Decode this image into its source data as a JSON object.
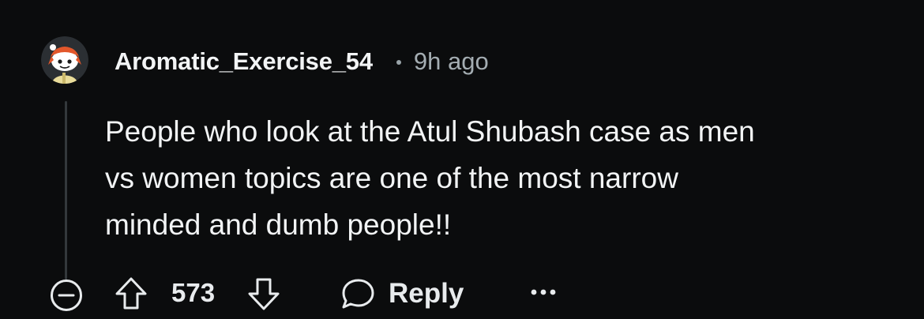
{
  "comment": {
    "author": "Aromatic_Exercise_54",
    "timestamp": "9h ago",
    "lines": [
      "People who look at the Atul Shubash case as men",
      "vs women topics are one of the most narrow",
      "minded and dumb people!!"
    ],
    "avatar_icon": "snoo-avatar-icon"
  },
  "actions": {
    "collapse_icon": "minus-circle-icon",
    "upvote_icon": "arrow-up-icon",
    "vote_count": "573",
    "downvote_icon": "arrow-down-icon",
    "reply_icon": "speech-bubble-icon",
    "reply_label": "Reply",
    "more_icon": "more-dots-icon"
  },
  "colors": {
    "background": "#0b0c0d",
    "text": "#f2f4f5",
    "muted": "#a4adb2",
    "thread_line": "#33383b"
  }
}
